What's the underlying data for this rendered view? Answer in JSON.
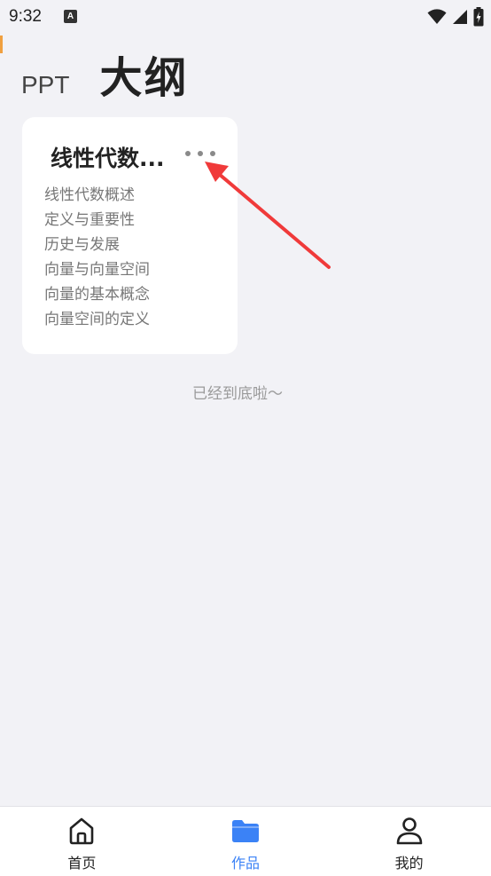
{
  "status_bar": {
    "time": "9:32",
    "notification_icon_letter": "A",
    "icons": [
      "wifi-icon",
      "signal-icon",
      "battery-charging-icon"
    ]
  },
  "header": {
    "prefix": "PPT",
    "title": "大纲"
  },
  "outline_card": {
    "title": "线性代数...",
    "more_icon": "more-horizontal-icon",
    "items": [
      "线性代数概述",
      "定义与重要性",
      "历史与发展",
      "向量与向量空间",
      "向量的基本概念",
      "向量空间的定义"
    ]
  },
  "end_of_list_text": "已经到底啦～",
  "annotation": {
    "color": "#f03a3a",
    "icon": "red-arrow-annotation"
  },
  "bottom_nav": {
    "active_color": "#3b82f6",
    "items": [
      {
        "label": "首页",
        "icon": "home-icon",
        "active": false
      },
      {
        "label": "作品",
        "icon": "folder-icon",
        "active": true
      },
      {
        "label": "我的",
        "icon": "user-icon",
        "active": false
      }
    ]
  }
}
